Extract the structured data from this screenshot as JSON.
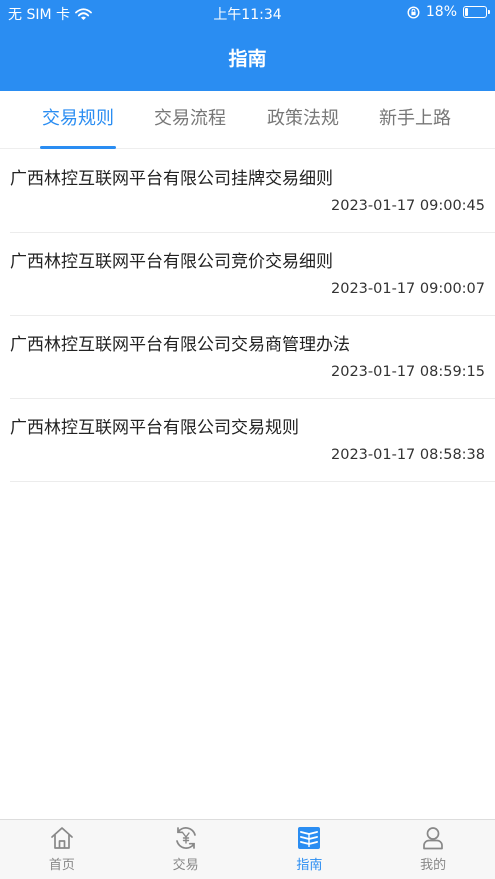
{
  "status_bar": {
    "carrier": "无 SIM 卡",
    "time": "上午11:34",
    "battery": "18%",
    "battery_level": 0.18
  },
  "header": {
    "title": "指南"
  },
  "tabs": [
    {
      "label": "交易规则",
      "active": true
    },
    {
      "label": "交易流程",
      "active": false
    },
    {
      "label": "政策法规",
      "active": false
    },
    {
      "label": "新手上路",
      "active": false
    }
  ],
  "articles": [
    {
      "title": "广西林控互联网平台有限公司挂牌交易细则",
      "date": "2023-01-17 09:00:45"
    },
    {
      "title": "广西林控互联网平台有限公司竞价交易细则",
      "date": "2023-01-17 09:00:07"
    },
    {
      "title": "广西林控互联网平台有限公司交易商管理办法",
      "date": "2023-01-17 08:59:15"
    },
    {
      "title": "广西林控互联网平台有限公司交易规则",
      "date": "2023-01-17 08:58:38"
    }
  ],
  "tabbar": [
    {
      "label": "首页",
      "icon": "home-icon"
    },
    {
      "label": "交易",
      "icon": "yen-exchange-icon"
    },
    {
      "label": "指南",
      "icon": "book-icon",
      "active": true
    },
    {
      "label": "我的",
      "icon": "user-icon"
    }
  ],
  "colors": {
    "primary": "#2a8df2",
    "inactive": "#888888"
  }
}
